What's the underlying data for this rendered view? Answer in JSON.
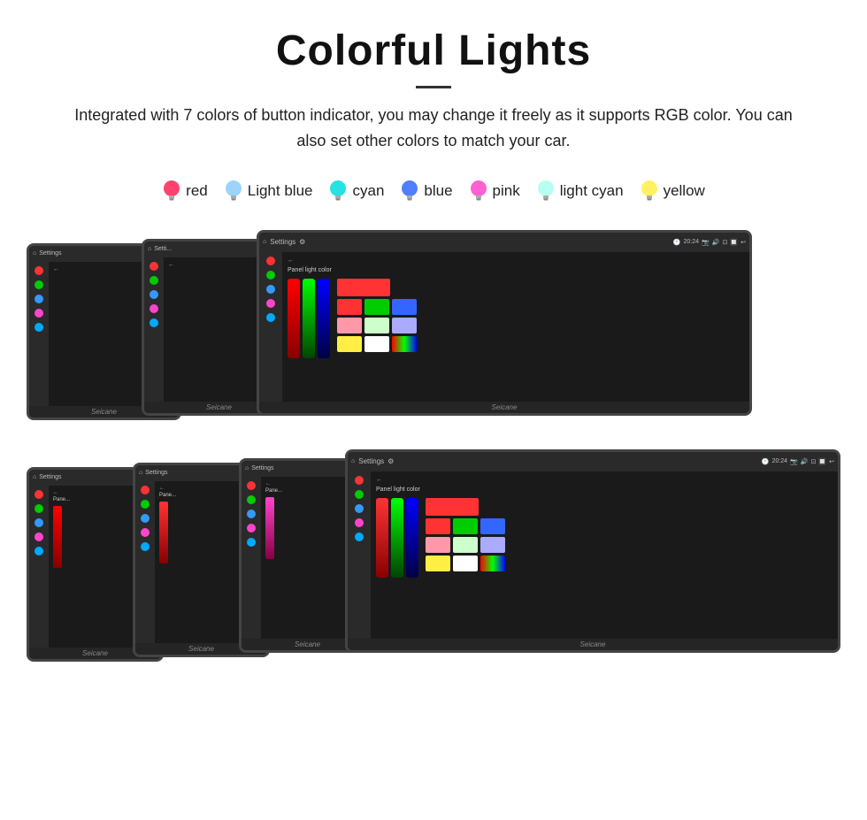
{
  "header": {
    "title": "Colorful Lights",
    "divider": true,
    "description": "Integrated with 7 colors of button indicator, you may change it freely as it supports RGB color. You can also set other colors to match your car."
  },
  "colors": [
    {
      "name": "red",
      "color": "#ff2255",
      "fill": "#ff2255"
    },
    {
      "name": "Light blue",
      "color": "#88ccff",
      "fill": "#88ccff"
    },
    {
      "name": "cyan",
      "color": "#00dddd",
      "fill": "#00dddd"
    },
    {
      "name": "blue",
      "color": "#3366ff",
      "fill": "#3366ff"
    },
    {
      "name": "pink",
      "color": "#ff44cc",
      "fill": "#ff44cc"
    },
    {
      "name": "light cyan",
      "color": "#aaffee",
      "fill": "#aaffee"
    },
    {
      "name": "yellow",
      "color": "#ffee44",
      "fill": "#ffee44"
    }
  ],
  "screens": {
    "topbar_label": "Settings",
    "panel_label": "Panel light color",
    "watermark": "Seicane"
  }
}
